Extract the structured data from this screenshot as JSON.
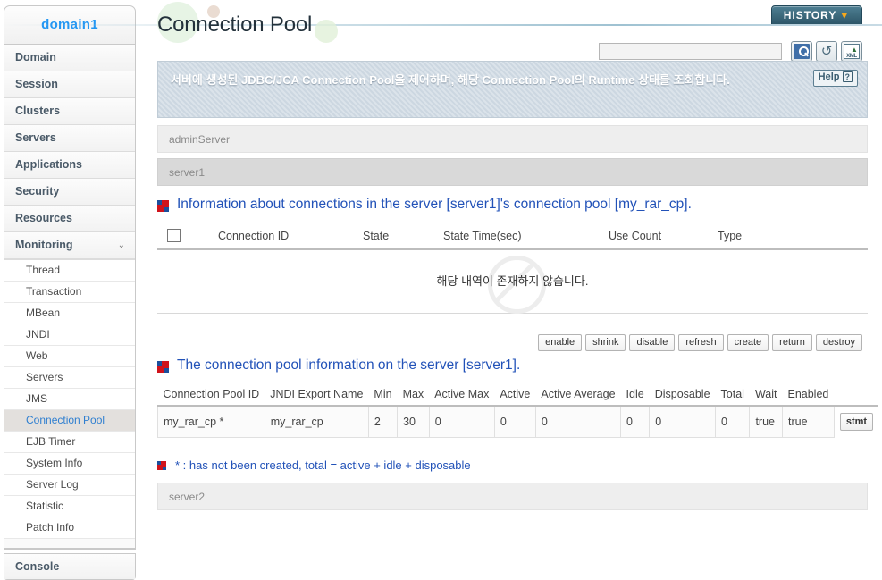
{
  "sidebar": {
    "domain_label": "domain1",
    "top_items": [
      {
        "label": "Domain",
        "expandable": false
      },
      {
        "label": "Session",
        "expandable": false
      },
      {
        "label": "Clusters",
        "expandable": false
      },
      {
        "label": "Servers",
        "expandable": false
      },
      {
        "label": "Applications",
        "expandable": false
      },
      {
        "label": "Security",
        "expandable": false
      },
      {
        "label": "Resources",
        "expandable": false
      },
      {
        "label": "Monitoring",
        "expandable": true,
        "chevron": "⌄"
      }
    ],
    "monitoring_sub_items": [
      {
        "label": "Thread",
        "active": false
      },
      {
        "label": "Transaction",
        "active": false
      },
      {
        "label": "MBean",
        "active": false
      },
      {
        "label": "JNDI",
        "active": false
      },
      {
        "label": "Web",
        "active": false
      },
      {
        "label": "Servers",
        "active": false
      },
      {
        "label": "JMS",
        "active": false
      },
      {
        "label": "Connection Pool",
        "active": true
      },
      {
        "label": "EJB Timer",
        "active": false
      },
      {
        "label": "System Info",
        "active": false
      },
      {
        "label": "Server Log",
        "active": false
      },
      {
        "label": "Statistic",
        "active": false
      },
      {
        "label": "Patch Info",
        "active": false
      }
    ],
    "console_label": "Console"
  },
  "header": {
    "page_title": "Connection Pool",
    "history_label": "HISTORY",
    "history_chevron": "▼"
  },
  "search": {
    "value": "",
    "placeholder": "",
    "search_icon": "search-icon",
    "refresh_icon": "refresh-icon",
    "xml_icon": "xml-export-icon",
    "xml_label": "XML",
    "xml_arrow": "▲"
  },
  "banner": {
    "description": "서버에 생성된 JDBC/JCA Connection Pool을 제어하며, 해당 Connection Pool의 Runtime 상태를 조회합니다.",
    "help_label": "Help",
    "help_mark": "?"
  },
  "servers": {
    "admin_server": "adminServer",
    "server1": "server1",
    "server2": "server2"
  },
  "connections_section": {
    "heading": "Information about connections in the server [server1]'s connection pool [my_rar_cp].",
    "columns": [
      "Connection ID",
      "State",
      "State Time(sec)",
      "Use Count",
      "Type"
    ],
    "rows": [],
    "empty_message": "해당 내역이 존재하지 않습니다."
  },
  "actions": {
    "buttons": [
      "enable",
      "shrink",
      "disable",
      "refresh",
      "create",
      "return",
      "destroy"
    ]
  },
  "pool_section": {
    "heading": "The connection pool information on the server [server1].",
    "columns": [
      "Connection Pool ID",
      "JNDI Export Name",
      "Min",
      "Max",
      "Active Max",
      "Active",
      "Active Average",
      "Idle",
      "Disposable",
      "Total",
      "Wait",
      "Enabled"
    ],
    "rows": [
      {
        "connection_pool_id": "my_rar_cp *",
        "jndi_export_name": "my_rar_cp",
        "min": "2",
        "max": "30",
        "active_max": "0",
        "active": "0",
        "active_average": "0",
        "idle": "0",
        "disposable": "0",
        "total": "0",
        "wait": "true",
        "enabled": "true",
        "stmt_label": "stmt"
      }
    ],
    "footnote": "* : has not been created, total = active + idle + disposable"
  },
  "colors": {
    "accent_blue": "#2252b8",
    "link_blue": "#2f7fd0",
    "brand_blue": "#2196f3",
    "history_bg": "#2c5466",
    "history_chevron": "#f7a81b",
    "banner_bg": "#ccd7e1",
    "row_light": "#eeeeee",
    "row_dark": "#d9d9d9",
    "marker_red": "#d0131b"
  }
}
